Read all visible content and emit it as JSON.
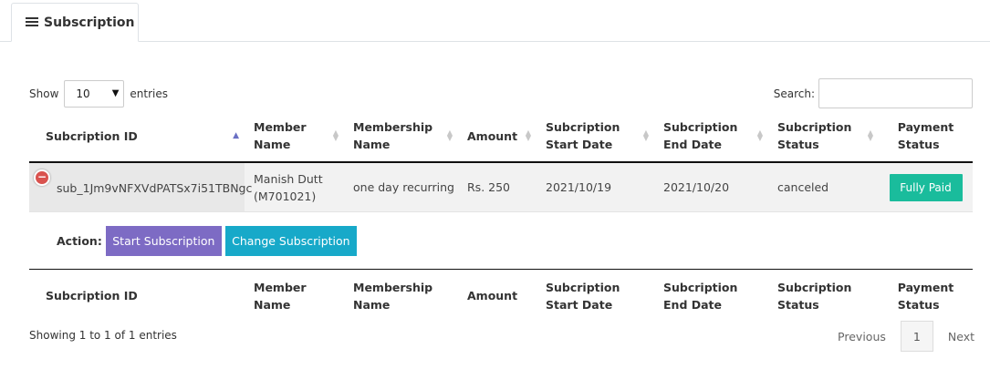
{
  "tab": {
    "label": "Subscription",
    "icon": "list-icon"
  },
  "controls": {
    "show_label": "Show",
    "entries_value": "10",
    "entries_label": "entries",
    "search_label": "Search:",
    "search_value": ""
  },
  "table": {
    "headers": [
      [
        "Subcription ID"
      ],
      [
        "Member",
        "Name"
      ],
      [
        "Membership",
        "Name"
      ],
      [
        "Amount"
      ],
      [
        "Subcription",
        "Start Date"
      ],
      [
        "Subcription",
        "End Date"
      ],
      [
        "Subcription",
        "Status"
      ],
      [
        "Payment",
        "Status"
      ]
    ],
    "rows": [
      {
        "subscription_id": "sub_1Jm9vNFXVdPATSx7i51TBNgc",
        "member_name": "Manish Dutt",
        "member_code": "(M701021)",
        "membership_name": "one day recurring",
        "amount": "Rs. 250",
        "start_date": "2021/10/19",
        "end_date": "2021/10/20",
        "status": "canceled",
        "payment_status": "Fully Paid"
      }
    ],
    "action_label": "Action:",
    "start_button": "Start Subscription",
    "change_button": "Change Subscription"
  },
  "footer": {
    "info": "Showing 1 to 1 of 1 entries",
    "previous": "Previous",
    "page": "1",
    "next": "Next"
  },
  "colors": {
    "accent_sort": "#6a70c4",
    "paid": "#1abc9c",
    "start": "#7d6bc4",
    "change": "#17a9c9",
    "collapse": "#d9534f"
  }
}
